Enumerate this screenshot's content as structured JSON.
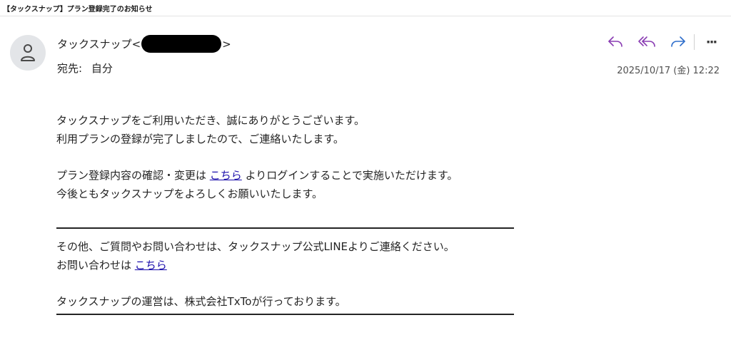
{
  "window": {
    "title": "【タックスナップ】プラン登録完了のお知らせ"
  },
  "header": {
    "sender_name": "タックスナップ",
    "sender_open": "<",
    "sender_close": ">",
    "to_label": "宛先:",
    "to_value": "自分",
    "date": "2025/10/17 (金) 12:22",
    "avatar_icon": "person-icon"
  },
  "actions": {
    "reply_icon": "reply-icon",
    "reply_all_icon": "reply-all-icon",
    "forward_icon": "forward-icon",
    "more_icon": "more-icon",
    "more_glyph": "···",
    "colors": {
      "reply": "#8a3db3",
      "forward": "#2f6ecb"
    }
  },
  "body": {
    "p1_line1": "タックスナップをご利用いただき、誠にありがとうございます。",
    "p1_line2": "利用プランの登録が完了しましたので、ご連絡いたします。",
    "p2_line1_before": "プラン登録内容の確認・変更は ",
    "p2_link": "こちら",
    "p2_line1_after": " よりログインすることで実施いただけます。",
    "p2_line2": "今後ともタックスナップをよろしくお願いいたします。",
    "p3_line1": "その他、ご質問やお問い合わせは、タックスナップ公式LINEよりご連絡ください。",
    "p3_line2_before": "お問い合わせは ",
    "p3_link": "こちら",
    "p4_line1": "タックスナップの運営は、株式会社TxToが行っております。",
    "link_color": "#1a0dab"
  }
}
